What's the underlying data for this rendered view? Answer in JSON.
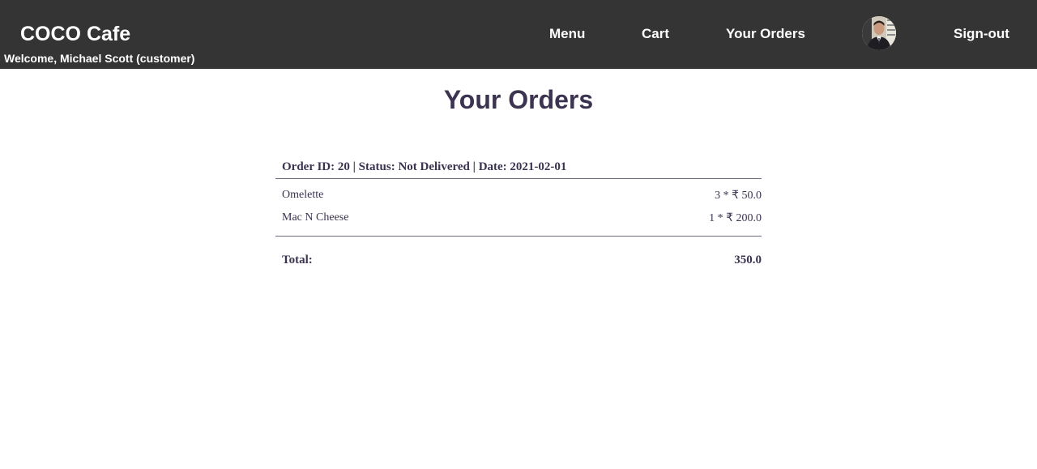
{
  "navbar": {
    "brand": "COCO Cafe",
    "welcome": "Welcome, Michael Scott (customer)",
    "links": {
      "menu": "Menu",
      "cart": "Cart",
      "orders": "Your Orders",
      "signout": "Sign-out"
    },
    "avatar_icon": "user-profile-photo",
    "background_color": "#353434"
  },
  "main": {
    "title": "Your Orders",
    "orders": [
      {
        "header": "Order ID: 20 | Status: Not Delivered | Date: 2021-02-01",
        "items": [
          {
            "name": "Omelette",
            "qty_price": "3 * ₹ 50.0"
          },
          {
            "name": "Mac N Cheese",
            "qty_price": "1 * ₹ 200.0"
          }
        ],
        "total_label": "Total:",
        "total_value": "350.0"
      }
    ]
  },
  "colors": {
    "text": "#3b3350",
    "nav_text": "#ffffff"
  }
}
